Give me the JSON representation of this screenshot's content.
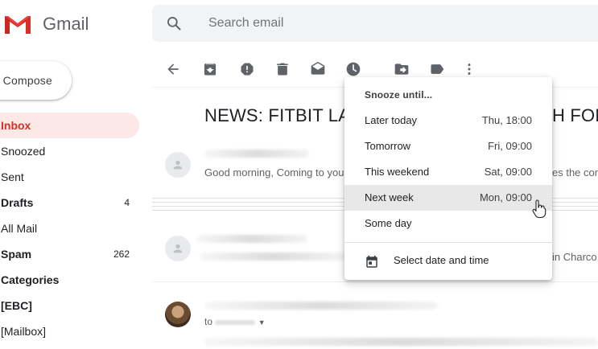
{
  "app": {
    "name": "Gmail"
  },
  "search": {
    "placeholder": "Search email"
  },
  "compose": {
    "label": "Compose"
  },
  "sidebar": {
    "items": [
      {
        "label": "Inbox",
        "count": "",
        "active": true,
        "bold": true
      },
      {
        "label": "Snoozed",
        "count": ""
      },
      {
        "label": "Sent",
        "count": ""
      },
      {
        "label": "Drafts",
        "count": "4",
        "bold": true
      },
      {
        "label": "All Mail",
        "count": ""
      },
      {
        "label": "Spam",
        "count": "262",
        "bold": true
      },
      {
        "label": "Categories",
        "count": "",
        "bold": true
      },
      {
        "label": "[EBC]",
        "count": "",
        "bold": true
      },
      {
        "label": "[Mailbox]",
        "count": ""
      }
    ]
  },
  "toolbar": {
    "icons": [
      "back-arrow-icon",
      "archive-icon",
      "report-spam-icon",
      "delete-icon",
      "mark-unread-icon",
      "snooze-clock-icon",
      "move-to-icon",
      "label-icon",
      "more-vert-icon"
    ]
  },
  "message": {
    "subject_left": "NEWS: FITBIT LAU",
    "subject_right": "H FOR",
    "rows": [
      {
        "snippet_left": "Good morning, Coming to you",
        "snippet_right": "es the cor"
      },
      {
        "snippet_right": "in Charco"
      },
      {
        "to_label": "to"
      }
    ]
  },
  "snooze_menu": {
    "title": "Snooze until...",
    "options": [
      {
        "label": "Later today",
        "when": "Thu, 18:00"
      },
      {
        "label": "Tomorrow",
        "when": "Fri, 09:00"
      },
      {
        "label": "This weekend",
        "when": "Sat, 09:00"
      },
      {
        "label": "Next week",
        "when": "Mon, 09:00",
        "hovered": true
      },
      {
        "label": "Some day",
        "when": ""
      }
    ],
    "select_date_label": "Select date and time"
  },
  "colors": {
    "accent_red": "#d93025",
    "inbox_highlight": "#fce8e6",
    "icon_grey": "#5f6368",
    "search_bg": "#f1f3f4",
    "menu_hover": "#e8e8e8"
  }
}
